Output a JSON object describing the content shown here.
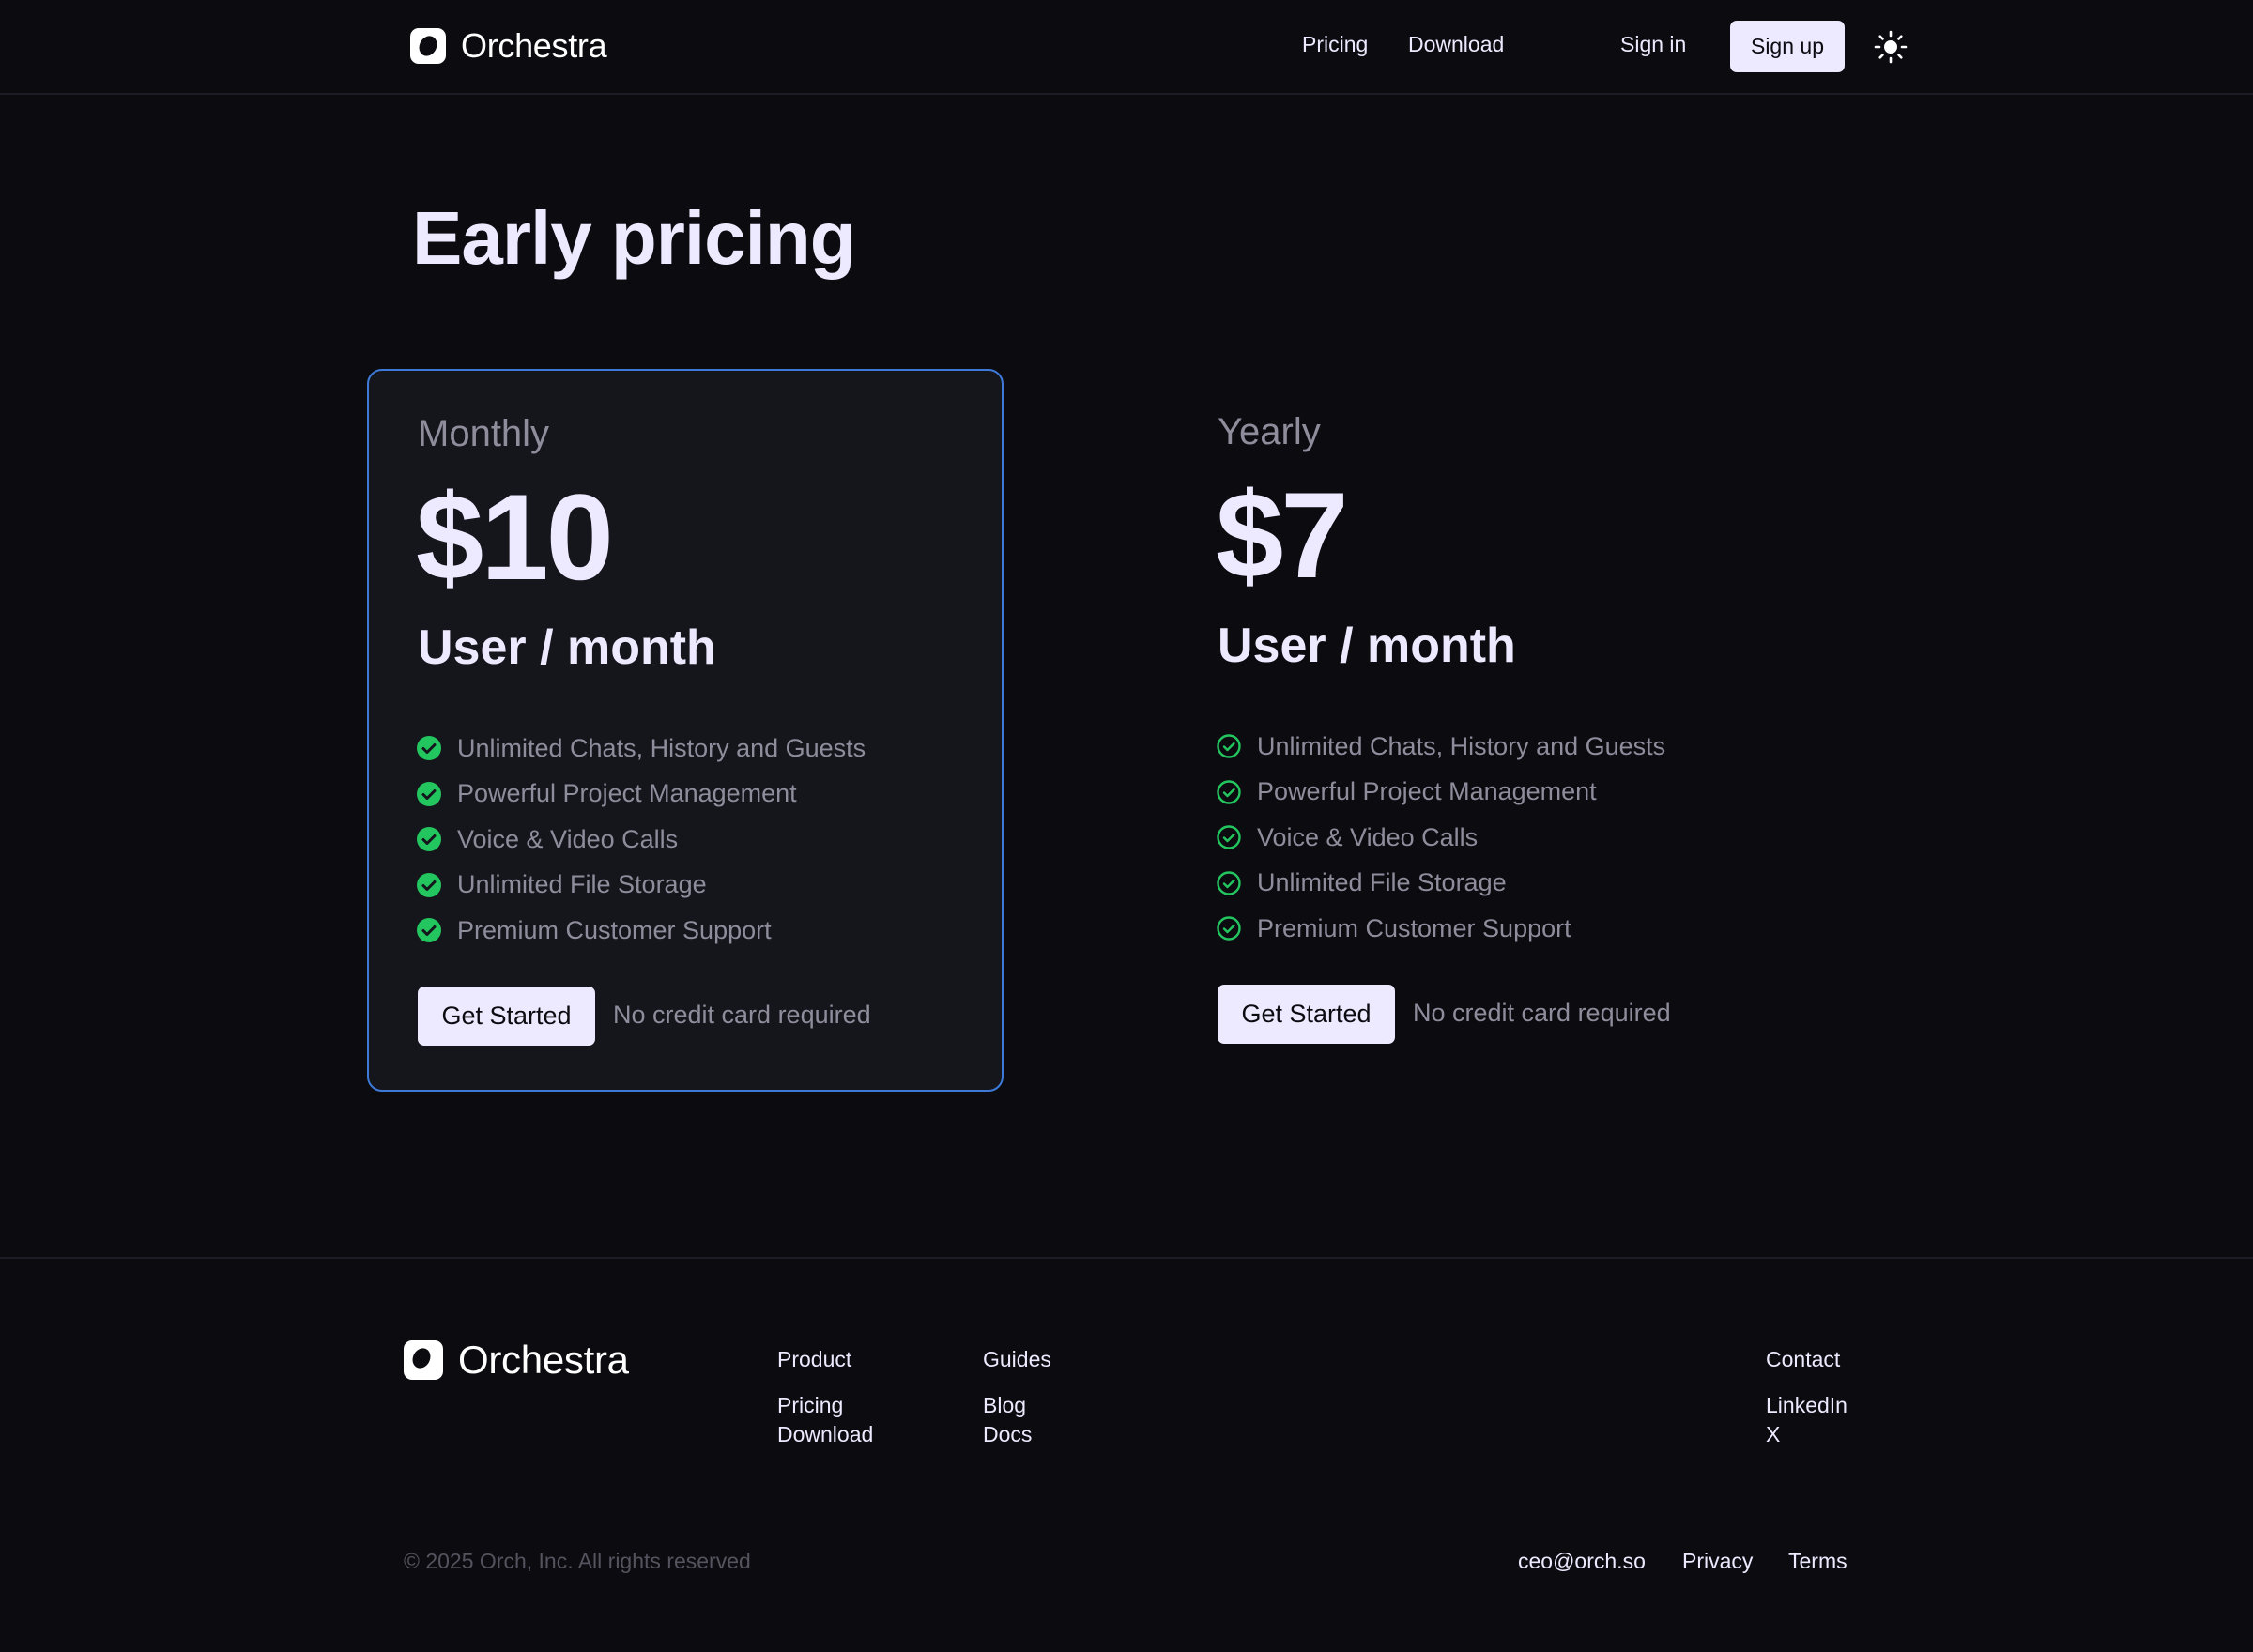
{
  "brand": {
    "name": "Orchestra"
  },
  "nav": {
    "links": [
      "Pricing",
      "Download"
    ],
    "sign_in": "Sign in",
    "sign_up": "Sign up",
    "theme_icon": "sun-icon"
  },
  "hero": {
    "title": "Early pricing"
  },
  "plans": [
    {
      "name": "Monthly",
      "price": "$10",
      "unit": "User / month",
      "features": [
        "Unlimited Chats, History and Guests",
        "Powerful Project Management",
        "Voice & Video Calls",
        "Unlimited File Storage",
        "Premium Customer Support"
      ],
      "cta": "Get Started",
      "note": "No credit card required"
    },
    {
      "name": "Yearly",
      "price": "$7",
      "unit": "User / month",
      "features": [
        "Unlimited Chats, History and Guests",
        "Powerful Project Management",
        "Voice & Video Calls",
        "Unlimited File Storage",
        "Premium Customer Support"
      ],
      "cta": "Get Started",
      "note": "No credit card required"
    }
  ],
  "footer": {
    "product": {
      "heading": "Product",
      "links": [
        "Pricing",
        "Download"
      ]
    },
    "guides": {
      "heading": "Guides",
      "links": [
        "Blog",
        "Docs"
      ]
    },
    "contact": {
      "heading": "Contact",
      "links": [
        "LinkedIn",
        "X"
      ]
    },
    "copyright": "© 2025 Orch, Inc. All rights reserved",
    "email": "ceo@orch.so",
    "privacy": "Privacy",
    "terms": "Terms"
  },
  "colors": {
    "background": "#0b0b10",
    "card": "#15151c",
    "card_border": "#3d7ad8",
    "accent_button": "#ede9fe",
    "check_green": "#22c55e",
    "muted_text": "#8f8d9c"
  }
}
